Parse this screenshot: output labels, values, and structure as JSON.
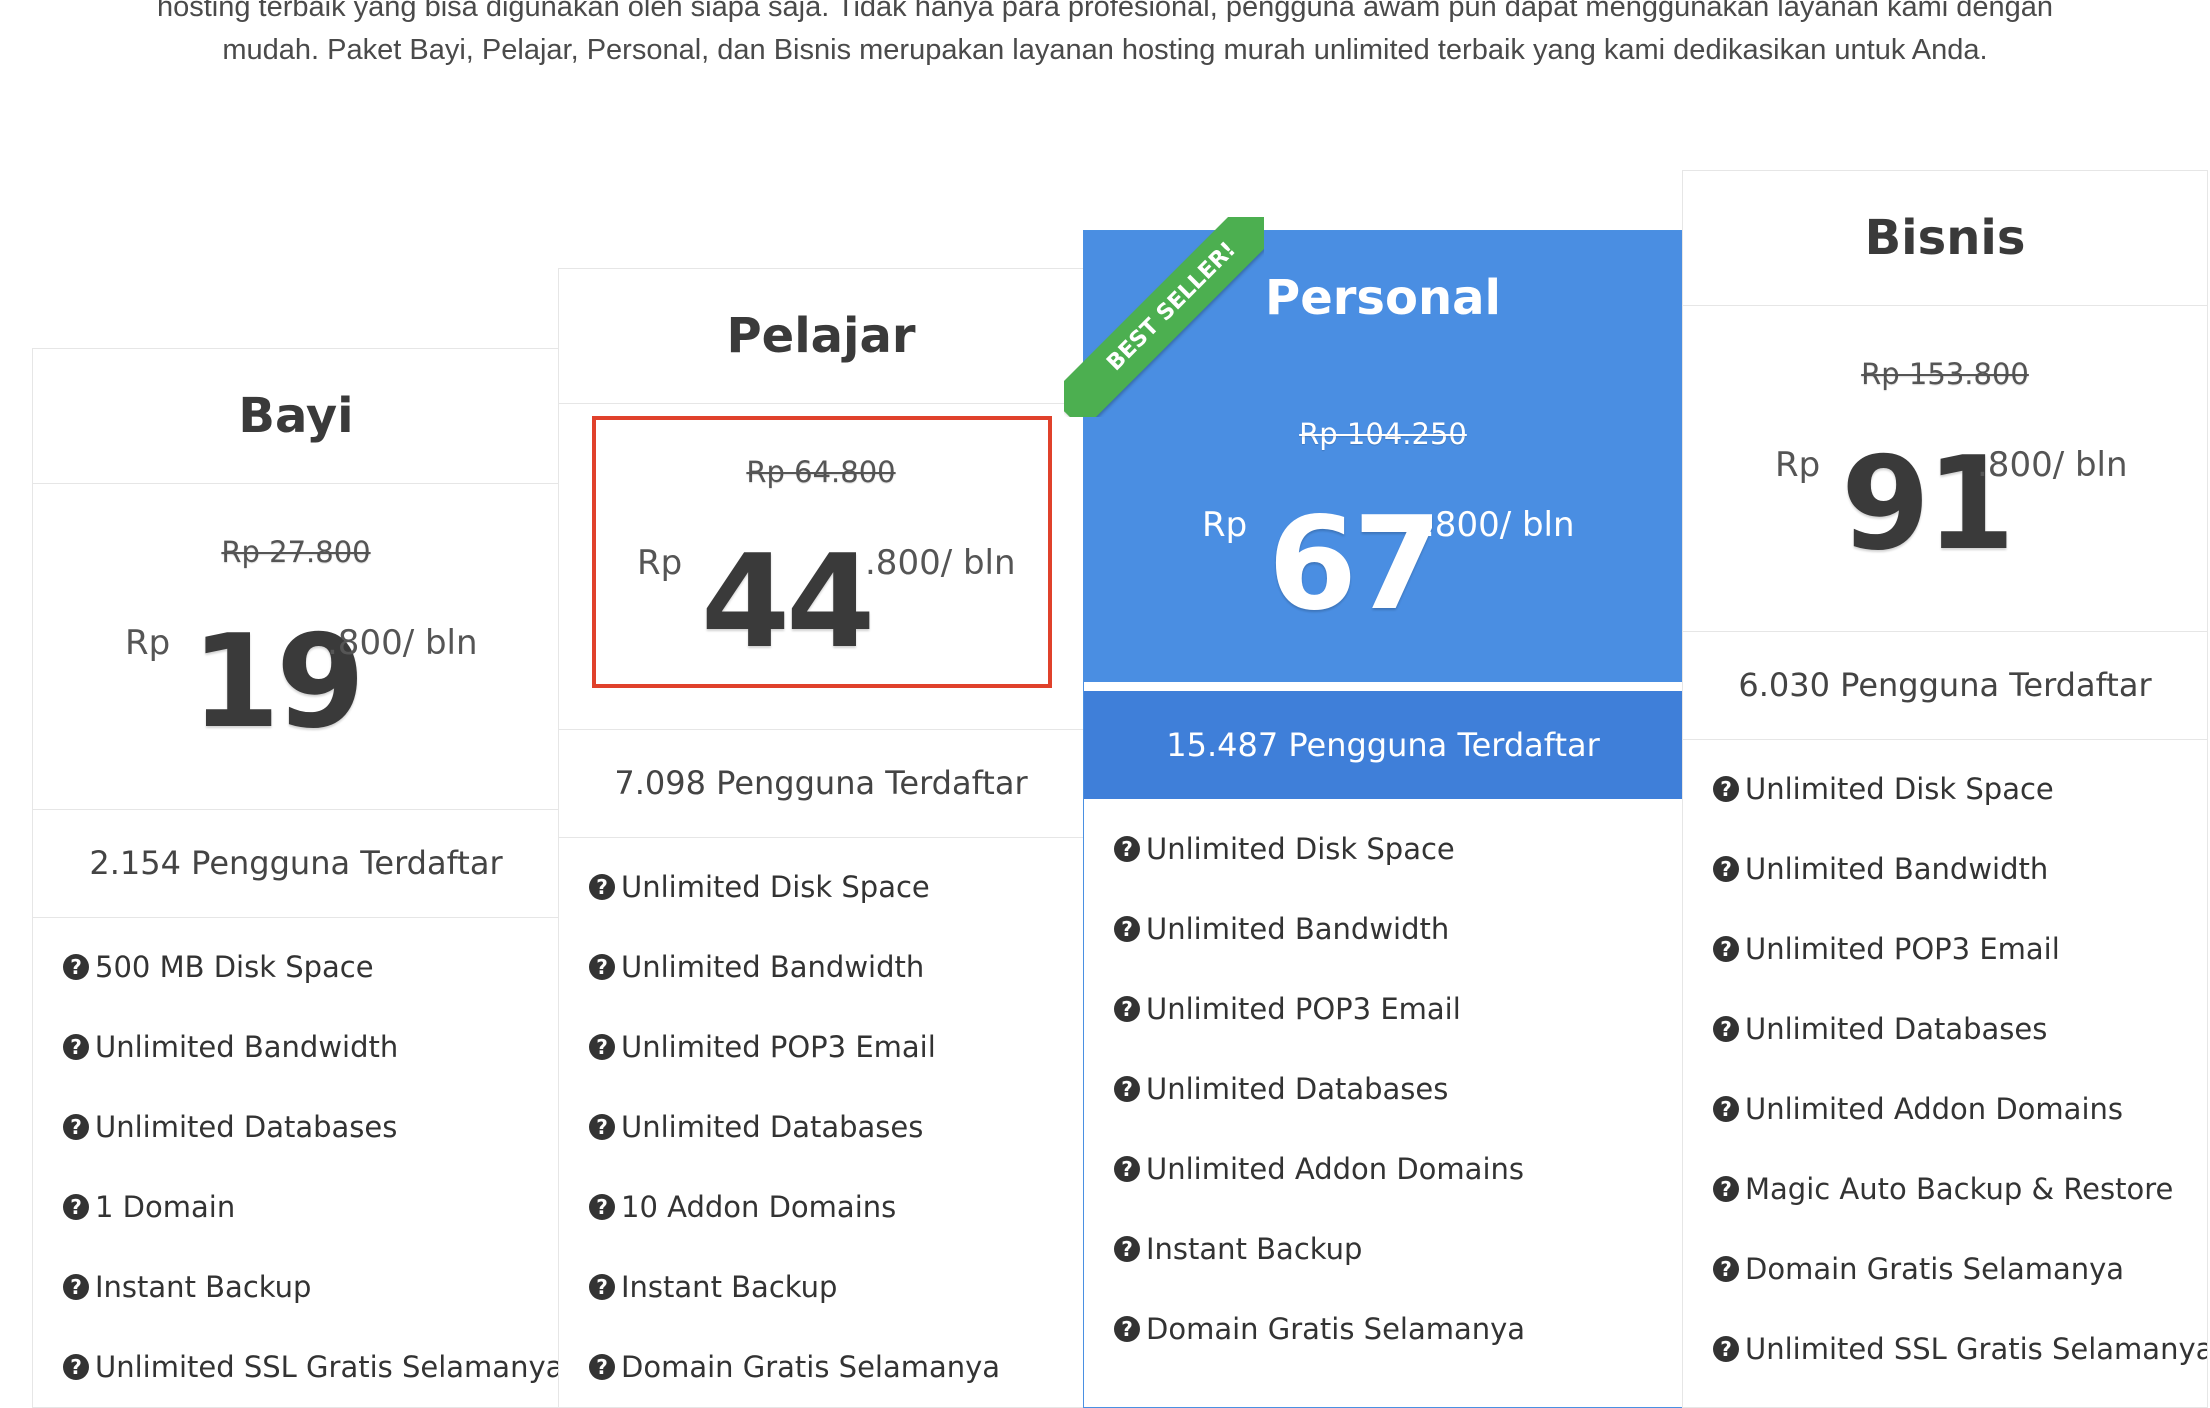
{
  "intro": {
    "line1": "hosting terbaik yang bisa digunakan oleh siapa saja. Tidak hanya para profesional, pengguna awam pun dapat menggunakan layanan kami dengan",
    "line2": "mudah. Paket Bayi, Pelajar, Personal, dan Bisnis merupakan layanan hosting murah unlimited terbaik yang kami dedikasikan untuk Anda."
  },
  "plans": [
    {
      "name": "Bayi",
      "old_price": "Rp 27.800",
      "currency": "Rp",
      "price_main": "19",
      "price_suffix": ".800/ bln",
      "users": "2.154 Pengguna Terdaftar",
      "features": [
        "500 MB Disk Space",
        "Unlimited Bandwidth",
        "Unlimited Databases",
        "1 Domain",
        "Instant Backup",
        "Unlimited SSL Gratis Selamanya"
      ]
    },
    {
      "name": "Pelajar",
      "old_price": "Rp 64.800",
      "currency": "Rp",
      "price_main": "44",
      "price_suffix": ".800/ bln",
      "users": "7.098 Pengguna Terdaftar",
      "features": [
        "Unlimited Disk Space",
        "Unlimited Bandwidth",
        "Unlimited POP3 Email",
        "Unlimited Databases",
        "10 Addon Domains",
        "Instant Backup",
        "Domain Gratis Selamanya"
      ]
    },
    {
      "name": "Personal",
      "ribbon": "BEST SELLER!",
      "old_price": "Rp 104.250",
      "currency": "Rp",
      "price_main": "67",
      "price_suffix": ".800/ bln",
      "users": "15.487 Pengguna Terdaftar",
      "features": [
        "Unlimited Disk Space",
        "Unlimited Bandwidth",
        "Unlimited POP3 Email",
        "Unlimited Databases",
        "Unlimited Addon Domains",
        "Instant Backup",
        "Domain Gratis Selamanya"
      ]
    },
    {
      "name": "Bisnis",
      "old_price": "Rp 153.800",
      "currency": "Rp",
      "price_main": "91",
      "price_suffix": ".800/ bln",
      "users": "6.030 Pengguna Terdaftar",
      "features": [
        "Unlimited Disk Space",
        "Unlimited Bandwidth",
        "Unlimited POP3 Email",
        "Unlimited Databases",
        "Unlimited Addon Domains",
        "Magic Auto Backup & Restore",
        "Domain Gratis Selamanya",
        "Unlimited SSL Gratis Selamanya"
      ]
    }
  ],
  "icon": "question-circle-icon",
  "colors": {
    "accent_blue": "#4a8ee2",
    "users_blue": "#3f7fd9",
    "ribbon_green": "#4caf50",
    "highlight_red": "#e0412b"
  }
}
